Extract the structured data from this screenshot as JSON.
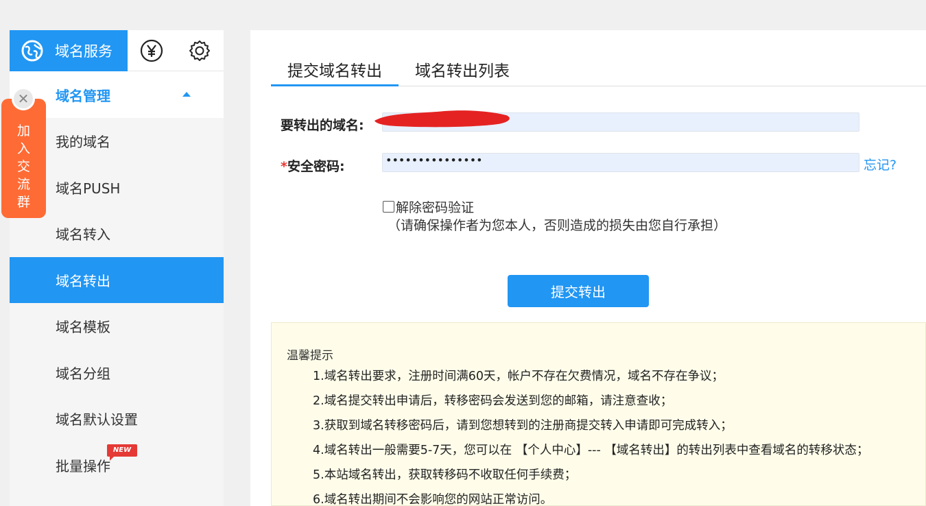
{
  "sidebar": {
    "main_tab_label": "域名服务",
    "group_label": "域名管理",
    "items": [
      {
        "label": "我的域名"
      },
      {
        "label": "域名PUSH"
      },
      {
        "label": "域名转入"
      },
      {
        "label": "域名转出"
      },
      {
        "label": "域名模板"
      },
      {
        "label": "域名分组"
      },
      {
        "label": "域名默认设置"
      },
      {
        "label": "批量操作"
      }
    ],
    "new_badge": "NEW"
  },
  "join_group": {
    "chars": [
      "加",
      "入",
      "交",
      "流",
      "群"
    ]
  },
  "main": {
    "tabs": [
      {
        "label": "提交域名转出"
      },
      {
        "label": "域名转出列表"
      }
    ],
    "form": {
      "domain_label": "要转出的域名:",
      "password_required_mark": "*",
      "password_label": "安全密码:",
      "password_value": "•••••••••••••••",
      "forgot_link": "忘记?",
      "disable_verify_label": "解除密码验证",
      "disable_verify_note": "（请确保操作者为您本人，否则造成的损失由您自行承担）",
      "submit_label": "提交转出"
    },
    "tips": {
      "title": "温馨提示",
      "items": [
        "1.域名转出要求，注册时间满60天，帐户不存在欠费情况，域名不存在争议；",
        "2.域名提交转出申请后，转移密码会发送到您的邮箱，请注意查收；",
        "3.获取到域名转移密码后，请到您想转到的注册商提交转入申请即可完成转入；",
        "4.域名转出一般需要5-7天，您可以在 【个人中心】--- 【域名转出】的转出列表中查看域名的转移状态；",
        "5.本站域名转出，获取转移码不收取任何手续费；",
        "6.域名转出期间不会影响您的网站正常访问。"
      ]
    }
  },
  "colors": {
    "accent": "#2196f3",
    "join_bg": "#ff6b35",
    "redaction": "#e52222",
    "tips_bg": "#fffdea"
  }
}
